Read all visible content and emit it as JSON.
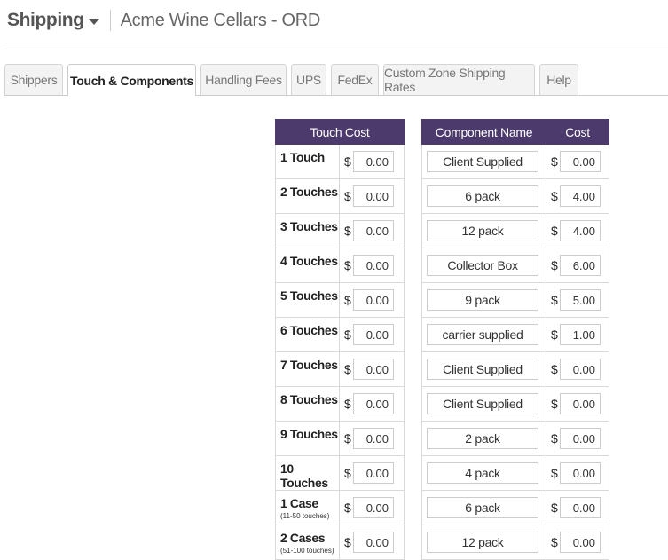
{
  "header": {
    "module": "Shipping",
    "shop": "Acme Wine Cellars - ORD"
  },
  "tabs": [
    {
      "label": "Shippers"
    },
    {
      "label": "Touch & Components"
    },
    {
      "label": "Handling Fees"
    },
    {
      "label": "UPS"
    },
    {
      "label": "FedEx"
    },
    {
      "label": "Custom Zone Shipping Rates"
    },
    {
      "label": "Help"
    }
  ],
  "active_tab": "Touch & Components",
  "currency_symbol": "$",
  "touch_table": {
    "header": "Touch Cost",
    "rows": [
      {
        "label": "1 Touch",
        "sub": "",
        "cost": "0.00"
      },
      {
        "label": "2 Touches",
        "sub": "",
        "cost": "0.00"
      },
      {
        "label": "3 Touches",
        "sub": "",
        "cost": "0.00"
      },
      {
        "label": "4 Touches",
        "sub": "",
        "cost": "0.00"
      },
      {
        "label": "5 Touches",
        "sub": "",
        "cost": "0.00"
      },
      {
        "label": "6 Touches",
        "sub": "",
        "cost": "0.00"
      },
      {
        "label": "7 Touches",
        "sub": "",
        "cost": "0.00"
      },
      {
        "label": "8 Touches",
        "sub": "",
        "cost": "0.00"
      },
      {
        "label": "9 Touches",
        "sub": "",
        "cost": "0.00"
      },
      {
        "label": "10 Touches",
        "sub": "",
        "cost": "0.00"
      },
      {
        "label": "1 Case",
        "sub": "(11-50 touches)",
        "cost": "0.00"
      },
      {
        "label": "2 Cases",
        "sub": "(51-100 touches)",
        "cost": "0.00"
      }
    ]
  },
  "component_table": {
    "headers": {
      "name": "Component Name",
      "cost": "Cost"
    },
    "rows": [
      {
        "name": "Client Supplied",
        "cost": "0.00"
      },
      {
        "name": "6 pack",
        "cost": "4.00"
      },
      {
        "name": "12 pack",
        "cost": "4.00"
      },
      {
        "name": "Collector Box",
        "cost": "6.00"
      },
      {
        "name": "9 pack",
        "cost": "5.00"
      },
      {
        "name": "carrier supplied",
        "cost": "1.00"
      },
      {
        "name": "Client Supplied",
        "cost": "0.00"
      },
      {
        "name": "Client Supplied",
        "cost": "0.00"
      },
      {
        "name": "2 pack",
        "cost": "0.00"
      },
      {
        "name": "4 pack",
        "cost": "0.00"
      },
      {
        "name": "6 pack",
        "cost": "0.00"
      },
      {
        "name": "12 pack",
        "cost": "0.00"
      }
    ]
  }
}
